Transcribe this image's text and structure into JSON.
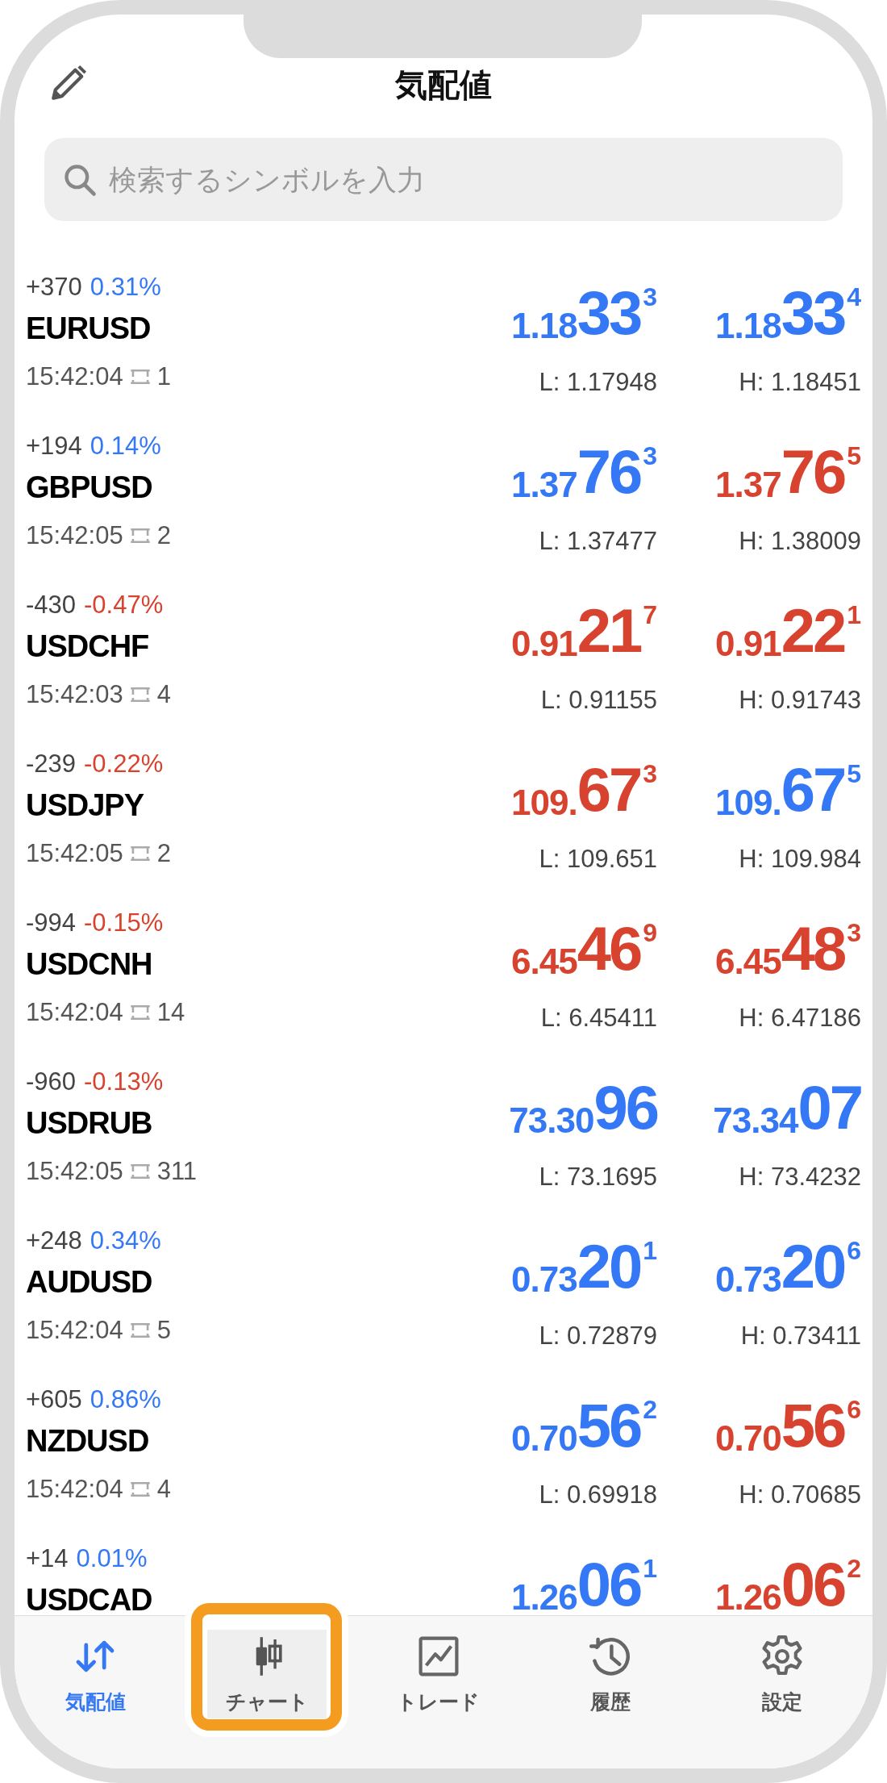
{
  "header": {
    "title": "気配値"
  },
  "search": {
    "placeholder": "検索するシンボルを入力"
  },
  "quotes": [
    {
      "change": "+370",
      "percent": {
        "text": "0.31%",
        "color": "#3478f6"
      },
      "symbol": "EURUSD",
      "time": "15:42:04",
      "spread": "1",
      "bid": {
        "prefix": "1.18",
        "big": "33",
        "sup": "3",
        "color": "#3478f6"
      },
      "ask": {
        "prefix": "1.18",
        "big": "33",
        "sup": "4",
        "color": "#3478f6"
      },
      "low": "L: 1.17948",
      "high": "H: 1.18451"
    },
    {
      "change": "+194",
      "percent": {
        "text": "0.14%",
        "color": "#3478f6"
      },
      "symbol": "GBPUSD",
      "time": "15:42:05",
      "spread": "2",
      "bid": {
        "prefix": "1.37",
        "big": "76",
        "sup": "3",
        "color": "#3478f6"
      },
      "ask": {
        "prefix": "1.37",
        "big": "76",
        "sup": "5",
        "color": "#d8432f"
      },
      "low": "L: 1.37477",
      "high": "H: 1.38009"
    },
    {
      "change": "-430",
      "percent": {
        "text": "-0.47%",
        "color": "#d8432f"
      },
      "symbol": "USDCHF",
      "time": "15:42:03",
      "spread": "4",
      "bid": {
        "prefix": "0.91",
        "big": "21",
        "sup": "7",
        "color": "#d8432f"
      },
      "ask": {
        "prefix": "0.91",
        "big": "22",
        "sup": "1",
        "color": "#d8432f"
      },
      "low": "L: 0.91155",
      "high": "H: 0.91743"
    },
    {
      "change": "-239",
      "percent": {
        "text": "-0.22%",
        "color": "#d8432f"
      },
      "symbol": "USDJPY",
      "time": "15:42:05",
      "spread": "2",
      "bid": {
        "prefix": "109.",
        "big": "67",
        "sup": "3",
        "color": "#d8432f"
      },
      "ask": {
        "prefix": "109.",
        "big": "67",
        "sup": "5",
        "color": "#3478f6"
      },
      "low": "L: 109.651",
      "high": "H: 109.984"
    },
    {
      "change": "-994",
      "percent": {
        "text": "-0.15%",
        "color": "#d8432f"
      },
      "symbol": "USDCNH",
      "time": "15:42:04",
      "spread": "14",
      "bid": {
        "prefix": "6.45",
        "big": "46",
        "sup": "9",
        "color": "#d8432f"
      },
      "ask": {
        "prefix": "6.45",
        "big": "48",
        "sup": "3",
        "color": "#d8432f"
      },
      "low": "L: 6.45411",
      "high": "H: 6.47186"
    },
    {
      "change": "-960",
      "percent": {
        "text": "-0.13%",
        "color": "#d8432f"
      },
      "symbol": "USDRUB",
      "time": "15:42:05",
      "spread": "311",
      "bid": {
        "prefix": "73.30",
        "big": "96",
        "color": "#3478f6"
      },
      "ask": {
        "prefix": "73.34",
        "big": "07",
        "color": "#3478f6"
      },
      "low": "L: 73.1695",
      "high": "H: 73.4232"
    },
    {
      "change": "+248",
      "percent": {
        "text": "0.34%",
        "color": "#3478f6"
      },
      "symbol": "AUDUSD",
      "time": "15:42:04",
      "spread": "5",
      "bid": {
        "prefix": "0.73",
        "big": "20",
        "sup": "1",
        "color": "#3478f6"
      },
      "ask": {
        "prefix": "0.73",
        "big": "20",
        "sup": "6",
        "color": "#3478f6"
      },
      "low": "L: 0.72879",
      "high": "H: 0.73411"
    },
    {
      "change": "+605",
      "percent": {
        "text": "0.86%",
        "color": "#3478f6"
      },
      "symbol": "NZDUSD",
      "time": "15:42:04",
      "spread": "4",
      "bid": {
        "prefix": "0.70",
        "big": "56",
        "sup": "2",
        "color": "#3478f6"
      },
      "ask": {
        "prefix": "0.70",
        "big": "56",
        "sup": "6",
        "color": "#d8432f"
      },
      "low": "L: 0.69918",
      "high": "H: 0.70685"
    },
    {
      "change": "+14",
      "percent": {
        "text": "0.01%",
        "color": "#3478f6"
      },
      "symbol": "USDCAD",
      "bid": {
        "prefix": "1.26",
        "big": "06",
        "sup": "1",
        "color": "#3478f6"
      },
      "ask": {
        "prefix": "1.26",
        "big": "06",
        "sup": "2",
        "color": "#d8432f"
      }
    }
  ],
  "tabs": [
    {
      "kind": "quotes",
      "label": "気配値",
      "selected": true,
      "highlighted": false
    },
    {
      "kind": "chart",
      "label": "チャート",
      "selected": false,
      "highlighted": true
    },
    {
      "kind": "trade",
      "label": "トレード",
      "selected": false,
      "highlighted": false
    },
    {
      "kind": "history",
      "label": "履歴",
      "selected": false,
      "highlighted": false
    },
    {
      "kind": "settings",
      "label": "設定",
      "selected": false,
      "highlighted": false
    }
  ]
}
